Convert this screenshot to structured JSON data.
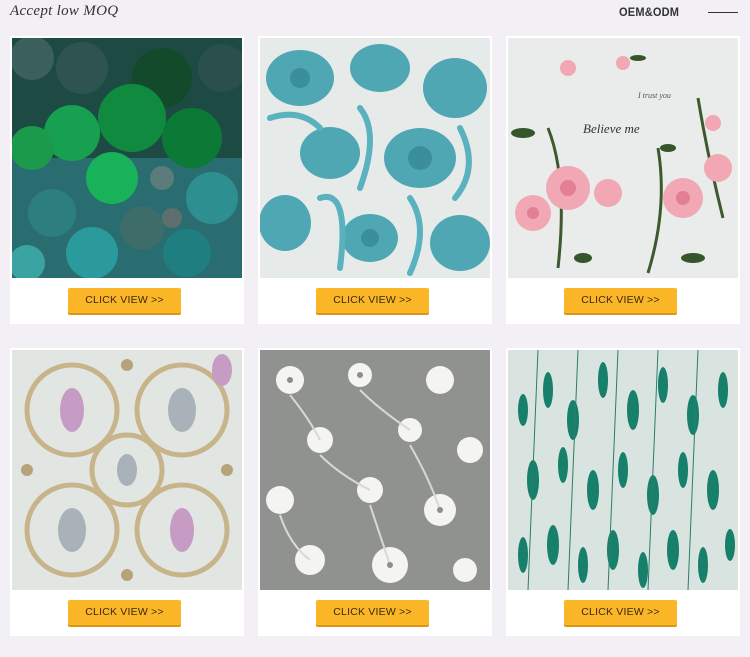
{
  "header": {
    "tagline": "Accept low MOQ",
    "oem_label": "OEM&ODM",
    "menu_icon": "hamburger-line-icon"
  },
  "products": [
    {
      "image": "green-sequin-lace-photo",
      "button_label": "CLICK VIEW >>"
    },
    {
      "image": "blue-floral-lace-photo",
      "button_label": "CLICK VIEW >>"
    },
    {
      "image": "pink-3d-flower-believe-me-photo",
      "button_label": "CLICK VIEW >>"
    },
    {
      "image": "beaded-pink-silver-lace-photo",
      "button_label": "CLICK VIEW >>"
    },
    {
      "image": "white-3d-flower-grey-lace-photo",
      "button_label": "CLICK VIEW >>"
    },
    {
      "image": "green-feather-lace-photo",
      "button_label": "CLICK VIEW >>"
    }
  ],
  "colors": {
    "background": "#f3f0f5",
    "button": "#fbb627"
  }
}
